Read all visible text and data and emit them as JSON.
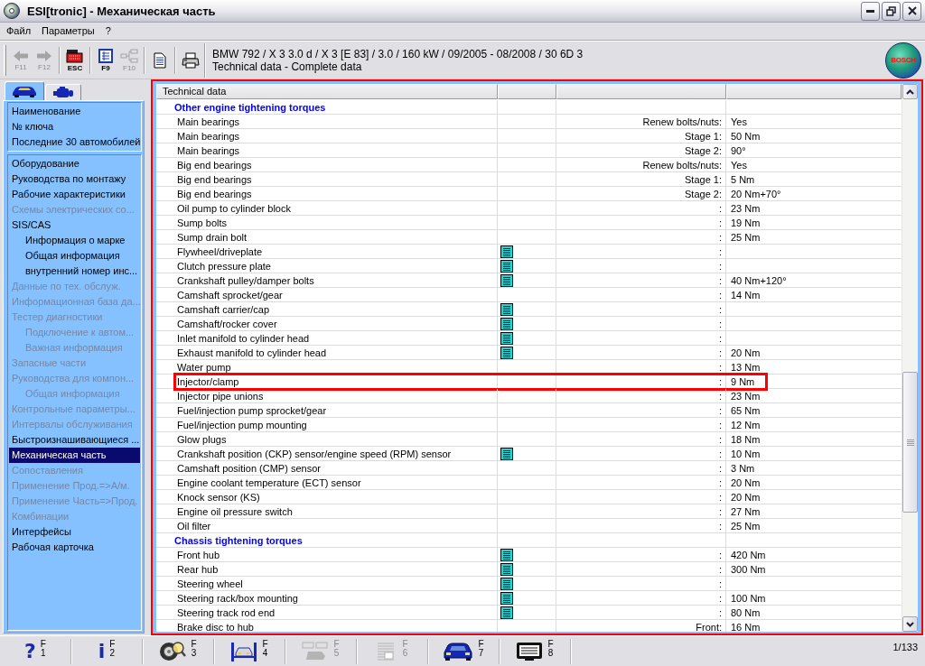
{
  "window": {
    "title": "ESI[tronic] - Механическая часть"
  },
  "menu": [
    "Файл",
    "Параметры",
    "?"
  ],
  "toolbar": {
    "groups": [
      [
        {
          "kind": "back",
          "label": "F11",
          "disabled": true
        },
        {
          "kind": "forward",
          "label": "F12",
          "disabled": true
        }
      ],
      [
        {
          "kind": "exit",
          "label": "ESC",
          "disabled": false
        }
      ],
      [
        {
          "kind": "list",
          "label": "F9",
          "disabled": false
        },
        {
          "kind": "tree",
          "label": "F10",
          "disabled": true
        }
      ],
      [
        {
          "kind": "document",
          "disabled": false
        }
      ],
      [
        {
          "kind": "printer",
          "disabled": false
        }
      ]
    ],
    "vehicle": "BMW 792 / X 3 3.0 d / X 3 [E 83] / 3.0 / 160 kW / 09/2005 - 08/2008 / 30 6D 3",
    "document": "Technical data - Complete data",
    "logo_text": "BOSCH"
  },
  "sidebar": {
    "tabs": [
      {
        "kind": "car",
        "selected": true
      },
      {
        "kind": "engine",
        "selected": false
      }
    ],
    "top_items": [
      {
        "label": "Наименование",
        "disabled": false,
        "selected": false
      },
      {
        "label": "№ ключа",
        "disabled": false,
        "selected": false
      },
      {
        "label": "Последние 30 автомобилей",
        "disabled": false,
        "selected": false
      }
    ],
    "items": [
      {
        "label": "Оборудование",
        "disabled": false,
        "selected": false
      },
      {
        "label": "Руководства по монтажу",
        "disabled": false,
        "selected": false
      },
      {
        "label": "Рабочие характеристики",
        "disabled": false,
        "selected": false
      },
      {
        "label": "Схемы электрических со...",
        "disabled": true,
        "selected": false
      },
      {
        "label": "SIS/CAS",
        "disabled": false,
        "selected": false,
        "children": [
          {
            "label": "Информация о марке",
            "disabled": false,
            "selected": false
          },
          {
            "label": "Общая информация",
            "disabled": false,
            "selected": false
          },
          {
            "label": "внутренний номер инс...",
            "disabled": false,
            "selected": false
          }
        ]
      },
      {
        "label": "Данные по тех. обслуж.",
        "disabled": true,
        "selected": false
      },
      {
        "label": "Информационная база да...",
        "disabled": true,
        "selected": false
      },
      {
        "label": "Тестер диагностики",
        "disabled": true,
        "selected": false,
        "children": [
          {
            "label": "Подключение к автом...",
            "disabled": true,
            "selected": false
          },
          {
            "label": "Важная информация",
            "disabled": true,
            "selected": false
          }
        ]
      },
      {
        "label": "Запасные части",
        "disabled": true,
        "selected": false
      },
      {
        "label": "Руководства для компон...",
        "disabled": true,
        "selected": false,
        "children": [
          {
            "label": "Общая информация",
            "disabled": true,
            "selected": false
          }
        ]
      },
      {
        "label": "Контрольные параметры...",
        "disabled": true,
        "selected": false
      },
      {
        "label": "Интервалы обслуживания",
        "disabled": true,
        "selected": false
      },
      {
        "label": "Быстроизнашивающиеся ...",
        "disabled": false,
        "selected": false
      },
      {
        "label": "Механическая часть",
        "disabled": false,
        "selected": true
      },
      {
        "label": "Сопоставления",
        "disabled": true,
        "selected": false
      },
      {
        "label": "Применение Прод.=>А/м.",
        "disabled": true,
        "selected": false
      },
      {
        "label": "Применение Часть=>Прод.",
        "disabled": true,
        "selected": false
      },
      {
        "label": "Комбинации",
        "disabled": true,
        "selected": false
      },
      {
        "label": "Интерфейсы",
        "disabled": false,
        "selected": false
      },
      {
        "label": "Рабочая карточка",
        "disabled": false,
        "selected": false
      }
    ]
  },
  "table": {
    "header": "Technical data",
    "rows": [
      {
        "kind": "section",
        "title": "Other engine tightening torques",
        "highlighted": false
      },
      {
        "kind": "item",
        "name": "Main bearings",
        "info_icon": false,
        "qualifier": "Renew bolts/nuts:",
        "value": "Yes",
        "highlighted": false
      },
      {
        "kind": "item",
        "name": "Main bearings",
        "info_icon": false,
        "qualifier": "Stage 1:",
        "value": "50 Nm",
        "highlighted": false
      },
      {
        "kind": "item",
        "name": "Main bearings",
        "info_icon": false,
        "qualifier": "Stage 2:",
        "value": "90°",
        "highlighted": false
      },
      {
        "kind": "item",
        "name": "Big end bearings",
        "info_icon": false,
        "qualifier": "Renew bolts/nuts:",
        "value": "Yes",
        "highlighted": false
      },
      {
        "kind": "item",
        "name": "Big end bearings",
        "info_icon": false,
        "qualifier": "Stage 1:",
        "value": "5 Nm",
        "highlighted": false
      },
      {
        "kind": "item",
        "name": "Big end bearings",
        "info_icon": false,
        "qualifier": "Stage 2:",
        "value": "20 Nm+70°",
        "highlighted": false
      },
      {
        "kind": "item",
        "name": "Oil pump to cylinder block",
        "info_icon": false,
        "qualifier": ":",
        "value": "23 Nm",
        "highlighted": false
      },
      {
        "kind": "item",
        "name": "Sump bolts",
        "info_icon": false,
        "qualifier": ":",
        "value": "19 Nm",
        "highlighted": false
      },
      {
        "kind": "item",
        "name": "Sump drain bolt",
        "info_icon": false,
        "qualifier": ":",
        "value": "25 Nm",
        "highlighted": false
      },
      {
        "kind": "item",
        "name": "Flywheel/driveplate",
        "info_icon": true,
        "qualifier": ":",
        "highlighted": false
      },
      {
        "kind": "item",
        "name": "Clutch pressure plate",
        "info_icon": true,
        "qualifier": ":",
        "highlighted": false
      },
      {
        "kind": "item",
        "name": "Crankshaft pulley/damper bolts",
        "info_icon": true,
        "qualifier": ":",
        "value": "40 Nm+120°",
        "highlighted": false
      },
      {
        "kind": "item",
        "name": "Camshaft sprocket/gear",
        "info_icon": false,
        "qualifier": ":",
        "value": "14 Nm",
        "highlighted": false
      },
      {
        "kind": "item",
        "name": "Camshaft carrier/cap",
        "info_icon": true,
        "qualifier": ":",
        "highlighted": false
      },
      {
        "kind": "item",
        "name": "Camshaft/rocker cover",
        "info_icon": true,
        "qualifier": ":",
        "highlighted": false
      },
      {
        "kind": "item",
        "name": "Inlet manifold to cylinder head",
        "info_icon": true,
        "qualifier": ":",
        "highlighted": false
      },
      {
        "kind": "item",
        "name": "Exhaust manifold to cylinder head",
        "info_icon": true,
        "qualifier": ":",
        "value": "20 Nm",
        "highlighted": false
      },
      {
        "kind": "item",
        "name": "Water pump",
        "info_icon": false,
        "qualifier": ":",
        "value": "13 Nm",
        "highlighted": false
      },
      {
        "kind": "item",
        "name": "Injector/clamp",
        "info_icon": false,
        "qualifier": ":",
        "value": "9 Nm",
        "highlighted": true
      },
      {
        "kind": "item",
        "name": "Injector pipe unions",
        "info_icon": false,
        "qualifier": ":",
        "value": "23 Nm",
        "highlighted": false
      },
      {
        "kind": "item",
        "name": "Fuel/injection pump sprocket/gear",
        "info_icon": false,
        "qualifier": ":",
        "value": "65 Nm",
        "highlighted": false
      },
      {
        "kind": "item",
        "name": "Fuel/injection pump mounting",
        "info_icon": false,
        "qualifier": ":",
        "value": "12 Nm",
        "highlighted": false
      },
      {
        "kind": "item",
        "name": "Glow plugs",
        "info_icon": false,
        "qualifier": ":",
        "value": "18 Nm",
        "highlighted": false
      },
      {
        "kind": "item",
        "name": "Crankshaft position (CKP) sensor/engine speed (RPM) sensor",
        "info_icon": true,
        "qualifier": ":",
        "value": "10 Nm",
        "highlighted": false
      },
      {
        "kind": "item",
        "name": "Camshaft position (CMP) sensor",
        "info_icon": false,
        "qualifier": ":",
        "value": "3 Nm",
        "highlighted": false
      },
      {
        "kind": "item",
        "name": "Engine coolant temperature (ECT) sensor",
        "info_icon": false,
        "qualifier": ":",
        "value": "20 Nm",
        "highlighted": false
      },
      {
        "kind": "item",
        "name": "Knock sensor (KS)",
        "info_icon": false,
        "qualifier": ":",
        "value": "20 Nm",
        "highlighted": false
      },
      {
        "kind": "item",
        "name": "Engine oil pressure switch",
        "info_icon": false,
        "qualifier": ":",
        "value": "27 Nm",
        "highlighted": false
      },
      {
        "kind": "item",
        "name": "Oil filter",
        "info_icon": false,
        "qualifier": ":",
        "value": "25 Nm",
        "highlighted": false
      },
      {
        "kind": "section",
        "title": "Chassis tightening torques",
        "highlighted": false
      },
      {
        "kind": "item",
        "name": "Front hub",
        "info_icon": true,
        "qualifier": ":",
        "value": "420 Nm",
        "highlighted": false
      },
      {
        "kind": "item",
        "name": "Rear hub",
        "info_icon": true,
        "qualifier": ":",
        "value": "300 Nm",
        "highlighted": false
      },
      {
        "kind": "item",
        "name": "Steering wheel",
        "info_icon": true,
        "qualifier": ":",
        "highlighted": false
      },
      {
        "kind": "item",
        "name": "Steering rack/box mounting",
        "info_icon": true,
        "qualifier": ":",
        "value": "100 Nm",
        "highlighted": false
      },
      {
        "kind": "item",
        "name": "Steering track rod end",
        "info_icon": true,
        "qualifier": ":",
        "value": "80 Nm",
        "highlighted": false
      },
      {
        "kind": "item",
        "name": "Brake disc to hub",
        "info_icon": false,
        "qualifier": "Front:",
        "value": "16 Nm",
        "highlighted": false
      }
    ]
  },
  "function_keys": [
    {
      "kind": "help",
      "glyph": "?",
      "letter": "F",
      "number": "1",
      "disabled": false
    },
    {
      "kind": "info",
      "glyph": "i",
      "letter": "F",
      "number": "2",
      "disabled": false
    },
    {
      "kind": "wheel",
      "letter": "F",
      "number": "3",
      "disabled": false
    },
    {
      "kind": "lift",
      "letter": "F",
      "number": "4",
      "disabled": false
    },
    {
      "kind": "parts",
      "letter": "F",
      "number": "5",
      "disabled": true
    },
    {
      "kind": "document",
      "letter": "F",
      "number": "6",
      "disabled": true
    },
    {
      "kind": "car",
      "letter": "F",
      "number": "7",
      "disabled": false
    },
    {
      "kind": "screen",
      "letter": "F",
      "number": "8",
      "disabled": false
    }
  ],
  "status": {
    "page": "1/133"
  }
}
